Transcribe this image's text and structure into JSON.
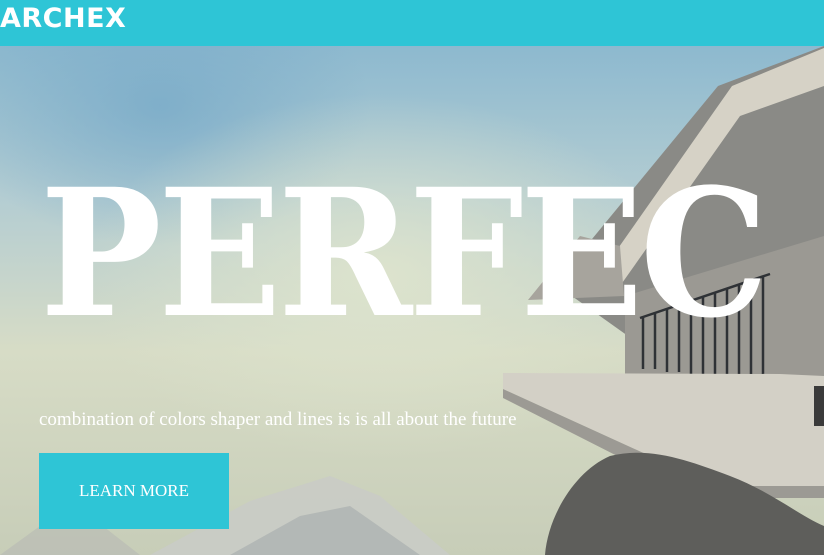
{
  "header": {
    "logo": "ARCHEX"
  },
  "hero": {
    "headline": "PERFEC",
    "tagline": "combination of colors shaper and lines is is all about the future",
    "cta_label": "LEARN MORE"
  },
  "colors": {
    "accent": "#2ec5d6",
    "text": "#ffffff"
  }
}
